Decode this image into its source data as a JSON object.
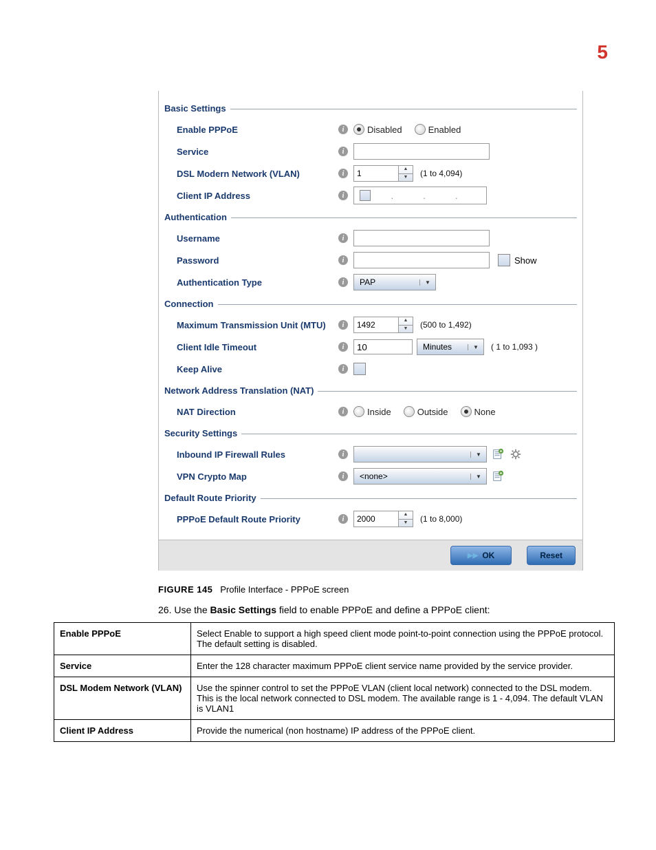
{
  "page_number": "5",
  "panel": {
    "sections": {
      "basic": "Basic Settings",
      "auth": "Authentication",
      "conn": "Connection",
      "nat": "Network Address Translation (NAT)",
      "sec": "Security Settings",
      "route": "Default Route Priority"
    },
    "labels": {
      "enable_pppoe": "Enable PPPoE",
      "service": "Service",
      "dsl_vlan": "DSL Modern Network (VLAN)",
      "client_ip": "Client IP Address",
      "username": "Username",
      "password": "Password",
      "auth_type": "Authentication Type",
      "mtu": "Maximum Transmission Unit (MTU)",
      "idle_timeout": "Client Idle Timeout",
      "keep_alive": "Keep Alive",
      "nat_dir": "NAT Direction",
      "inbound_fw": "Inbound IP Firewall Rules",
      "vpn_map": "VPN Crypto Map",
      "route_prio": "PPPoE Default Route Priority"
    },
    "radios": {
      "disabled": "Disabled",
      "enabled": "Enabled",
      "inside": "Inside",
      "outside": "Outside",
      "none": "None"
    },
    "values": {
      "vlan": "1",
      "auth_type": "PAP",
      "mtu": "1492",
      "idle": "10",
      "idle_unit": "Minutes",
      "vpn_map": "<none>",
      "route_prio": "2000"
    },
    "hints": {
      "vlan": "(1 to 4,094)",
      "mtu": "(500 to 1,492)",
      "idle": "( 1 to 1,093 )",
      "route": "(1 to 8,000)"
    },
    "show": "Show",
    "ok": "OK",
    "reset": "Reset"
  },
  "caption_label": "FIGURE 145",
  "caption_text": "Profile Interface - PPPoE screen",
  "step_prefix": "26. Use the ",
  "step_bold": "Basic Settings",
  "step_suffix": " field to enable PPPoE and define a PPPoE client:",
  "table": {
    "r1h": "Enable PPPoE",
    "r1d": "Select Enable to support a high speed client mode point-to-point connection using the PPPoE protocol. The default setting is disabled.",
    "r2h": "Service",
    "r2d": "Enter the 128 character maximum PPPoE client service name provided by the service provider.",
    "r3h": "DSL Modem Network (VLAN)",
    "r3d": "Use the spinner control to set the PPPoE VLAN (client local network) connected to the DSL modem. This is the local network connected to DSL modem. The available range is 1 - 4,094. The default VLAN is VLAN1",
    "r4h": "Client IP Address",
    "r4d": "Provide the numerical (non hostname) IP address of the PPPoE client."
  }
}
